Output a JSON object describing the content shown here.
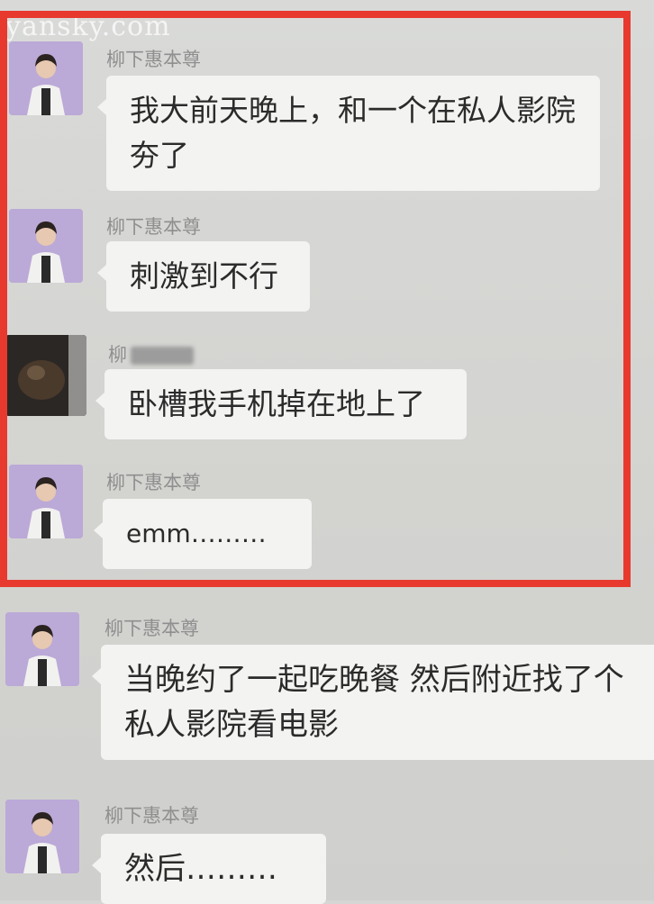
{
  "watermark": "yansky.com",
  "messages": [
    {
      "sender": "柳下惠本尊",
      "text": "我大前天晚上，和一个在私人影院 夯了"
    },
    {
      "sender": "柳下惠本尊",
      "text": "刺激到不行"
    },
    {
      "sender": "柳",
      "text": "卧槽我手机掉在地上了"
    },
    {
      "sender": "柳下惠本尊",
      "text": "emm………"
    },
    {
      "sender": "柳下惠本尊",
      "text": "当晚约了一起吃晚餐 然后附近找了个私人影院看电影"
    },
    {
      "sender": "柳下惠本尊",
      "text": "然后………"
    }
  ],
  "colors": {
    "highlight_border": "#e8392f",
    "avatar_bg": "#b9a8d6",
    "bubble_bg": "#f3f3f1"
  },
  "icons": {
    "avatar": "woman-portrait-icon",
    "avatar_dark": "dark-photo-avatar-icon"
  }
}
